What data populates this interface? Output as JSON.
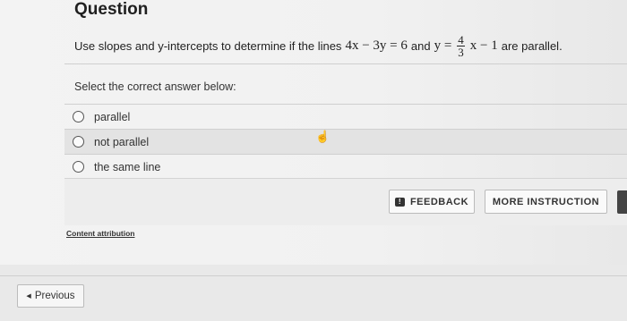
{
  "header": {
    "title": "Question"
  },
  "question": {
    "prefix": "Use slopes and y-intercepts to determine if the lines",
    "eq1": "4x − 3y = 6",
    "conj": "and",
    "eq2_left": "y =",
    "frac_num": "4",
    "frac_den": "3",
    "eq2_right": "x − 1",
    "suffix": "are parallel."
  },
  "answer": {
    "select_label": "Select the correct answer below:",
    "options": [
      {
        "label": "parallel"
      },
      {
        "label": "not parallel"
      },
      {
        "label": "the same line"
      }
    ]
  },
  "buttons": {
    "feedback": "FEEDBACK",
    "more_instruction": "MORE INSTRUCTION"
  },
  "attribution": "Content attribution",
  "footer": {
    "previous": "Previous"
  },
  "colors": {
    "background": "#f1f1f1",
    "border": "#bbbbbb"
  }
}
